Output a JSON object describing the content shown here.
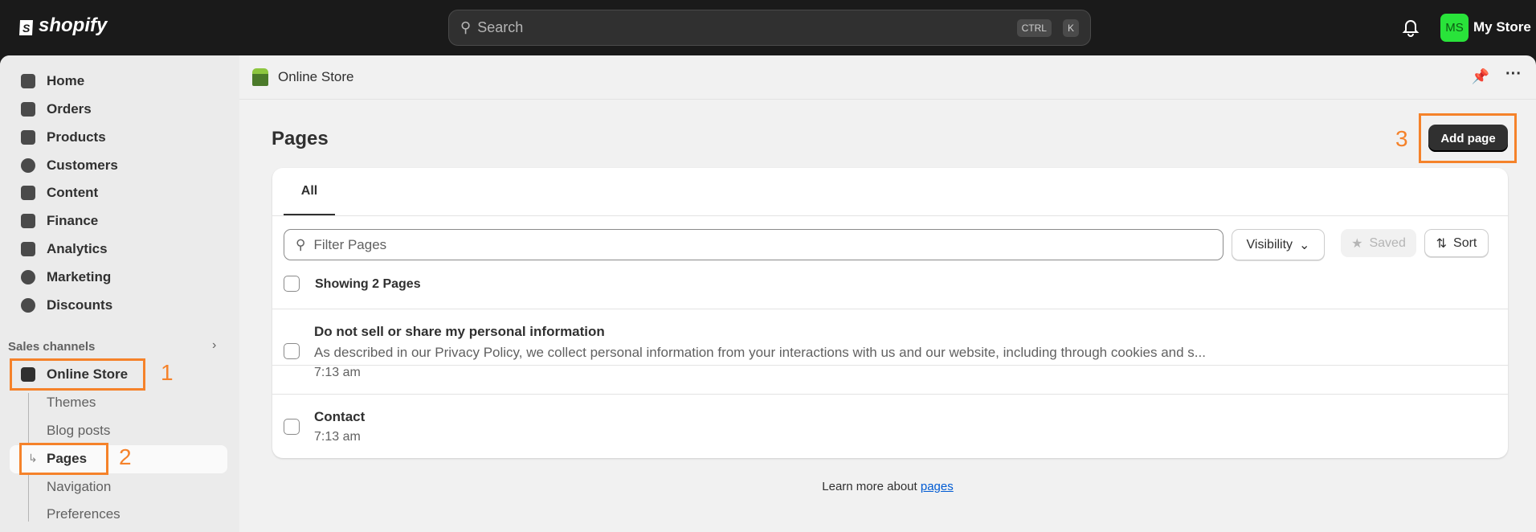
{
  "topbar": {
    "logo": "shopify",
    "search_placeholder": "Search",
    "kbd1": "CTRL",
    "kbd2": "K",
    "avatar_initials": "MS",
    "store_name": "My Store"
  },
  "sidebar": {
    "items": [
      {
        "label": "Home"
      },
      {
        "label": "Orders"
      },
      {
        "label": "Products"
      },
      {
        "label": "Customers"
      },
      {
        "label": "Content"
      },
      {
        "label": "Finance"
      },
      {
        "label": "Analytics"
      },
      {
        "label": "Marketing"
      },
      {
        "label": "Discounts"
      }
    ],
    "sales_channels": "Sales channels",
    "online_store": "Online Store",
    "sub_items": [
      {
        "label": "Themes"
      },
      {
        "label": "Blog posts"
      },
      {
        "label": "Pages"
      },
      {
        "label": "Navigation"
      },
      {
        "label": "Preferences"
      }
    ]
  },
  "header": {
    "title": "Online Store"
  },
  "main": {
    "title": "Pages",
    "add_page": "Add page",
    "tab_all": "All",
    "filter_placeholder": "Filter Pages",
    "visibility": "Visibility",
    "saved": "Saved",
    "sort": "Sort",
    "showing": "Showing 2 Pages",
    "rows": [
      {
        "title": "Do not sell or share my personal information",
        "desc": "As described in our Privacy Policy, we collect personal information from your interactions with us and our website, including through cookies and s...",
        "time": "7:13 am"
      },
      {
        "title": "Contact",
        "time": "7:13 am"
      }
    ],
    "learn_more": "Learn more about",
    "learn_link": "pages"
  },
  "annotations": {
    "a1": "1",
    "a2": "2",
    "a3": "3"
  },
  "colors": {
    "accent": "#f5822a",
    "avatar": "#29e33a"
  }
}
